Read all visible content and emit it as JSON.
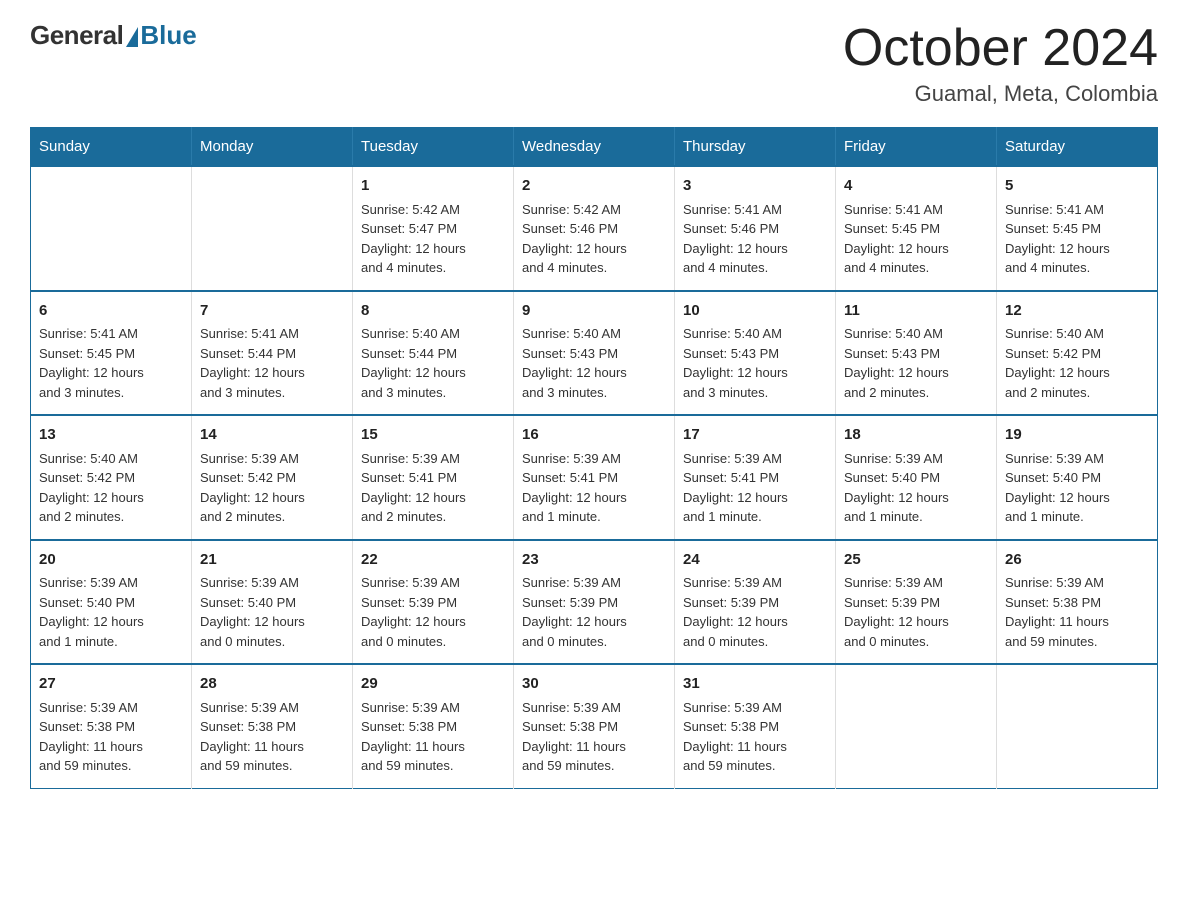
{
  "header": {
    "logo": {
      "general": "General",
      "blue": "Blue",
      "triangle_color": "#1a6b9a"
    },
    "title": "October 2024",
    "location": "Guamal, Meta, Colombia"
  },
  "calendar": {
    "days_of_week": [
      "Sunday",
      "Monday",
      "Tuesday",
      "Wednesday",
      "Thursday",
      "Friday",
      "Saturday"
    ],
    "weeks": [
      {
        "days": [
          {
            "number": "",
            "info": ""
          },
          {
            "number": "",
            "info": ""
          },
          {
            "number": "1",
            "info": "Sunrise: 5:42 AM\nSunset: 5:47 PM\nDaylight: 12 hours\nand 4 minutes."
          },
          {
            "number": "2",
            "info": "Sunrise: 5:42 AM\nSunset: 5:46 PM\nDaylight: 12 hours\nand 4 minutes."
          },
          {
            "number": "3",
            "info": "Sunrise: 5:41 AM\nSunset: 5:46 PM\nDaylight: 12 hours\nand 4 minutes."
          },
          {
            "number": "4",
            "info": "Sunrise: 5:41 AM\nSunset: 5:45 PM\nDaylight: 12 hours\nand 4 minutes."
          },
          {
            "number": "5",
            "info": "Sunrise: 5:41 AM\nSunset: 5:45 PM\nDaylight: 12 hours\nand 4 minutes."
          }
        ]
      },
      {
        "days": [
          {
            "number": "6",
            "info": "Sunrise: 5:41 AM\nSunset: 5:45 PM\nDaylight: 12 hours\nand 3 minutes."
          },
          {
            "number": "7",
            "info": "Sunrise: 5:41 AM\nSunset: 5:44 PM\nDaylight: 12 hours\nand 3 minutes."
          },
          {
            "number": "8",
            "info": "Sunrise: 5:40 AM\nSunset: 5:44 PM\nDaylight: 12 hours\nand 3 minutes."
          },
          {
            "number": "9",
            "info": "Sunrise: 5:40 AM\nSunset: 5:43 PM\nDaylight: 12 hours\nand 3 minutes."
          },
          {
            "number": "10",
            "info": "Sunrise: 5:40 AM\nSunset: 5:43 PM\nDaylight: 12 hours\nand 3 minutes."
          },
          {
            "number": "11",
            "info": "Sunrise: 5:40 AM\nSunset: 5:43 PM\nDaylight: 12 hours\nand 2 minutes."
          },
          {
            "number": "12",
            "info": "Sunrise: 5:40 AM\nSunset: 5:42 PM\nDaylight: 12 hours\nand 2 minutes."
          }
        ]
      },
      {
        "days": [
          {
            "number": "13",
            "info": "Sunrise: 5:40 AM\nSunset: 5:42 PM\nDaylight: 12 hours\nand 2 minutes."
          },
          {
            "number": "14",
            "info": "Sunrise: 5:39 AM\nSunset: 5:42 PM\nDaylight: 12 hours\nand 2 minutes."
          },
          {
            "number": "15",
            "info": "Sunrise: 5:39 AM\nSunset: 5:41 PM\nDaylight: 12 hours\nand 2 minutes."
          },
          {
            "number": "16",
            "info": "Sunrise: 5:39 AM\nSunset: 5:41 PM\nDaylight: 12 hours\nand 1 minute."
          },
          {
            "number": "17",
            "info": "Sunrise: 5:39 AM\nSunset: 5:41 PM\nDaylight: 12 hours\nand 1 minute."
          },
          {
            "number": "18",
            "info": "Sunrise: 5:39 AM\nSunset: 5:40 PM\nDaylight: 12 hours\nand 1 minute."
          },
          {
            "number": "19",
            "info": "Sunrise: 5:39 AM\nSunset: 5:40 PM\nDaylight: 12 hours\nand 1 minute."
          }
        ]
      },
      {
        "days": [
          {
            "number": "20",
            "info": "Sunrise: 5:39 AM\nSunset: 5:40 PM\nDaylight: 12 hours\nand 1 minute."
          },
          {
            "number": "21",
            "info": "Sunrise: 5:39 AM\nSunset: 5:40 PM\nDaylight: 12 hours\nand 0 minutes."
          },
          {
            "number": "22",
            "info": "Sunrise: 5:39 AM\nSunset: 5:39 PM\nDaylight: 12 hours\nand 0 minutes."
          },
          {
            "number": "23",
            "info": "Sunrise: 5:39 AM\nSunset: 5:39 PM\nDaylight: 12 hours\nand 0 minutes."
          },
          {
            "number": "24",
            "info": "Sunrise: 5:39 AM\nSunset: 5:39 PM\nDaylight: 12 hours\nand 0 minutes."
          },
          {
            "number": "25",
            "info": "Sunrise: 5:39 AM\nSunset: 5:39 PM\nDaylight: 12 hours\nand 0 minutes."
          },
          {
            "number": "26",
            "info": "Sunrise: 5:39 AM\nSunset: 5:38 PM\nDaylight: 11 hours\nand 59 minutes."
          }
        ]
      },
      {
        "days": [
          {
            "number": "27",
            "info": "Sunrise: 5:39 AM\nSunset: 5:38 PM\nDaylight: 11 hours\nand 59 minutes."
          },
          {
            "number": "28",
            "info": "Sunrise: 5:39 AM\nSunset: 5:38 PM\nDaylight: 11 hours\nand 59 minutes."
          },
          {
            "number": "29",
            "info": "Sunrise: 5:39 AM\nSunset: 5:38 PM\nDaylight: 11 hours\nand 59 minutes."
          },
          {
            "number": "30",
            "info": "Sunrise: 5:39 AM\nSunset: 5:38 PM\nDaylight: 11 hours\nand 59 minutes."
          },
          {
            "number": "31",
            "info": "Sunrise: 5:39 AM\nSunset: 5:38 PM\nDaylight: 11 hours\nand 59 minutes."
          },
          {
            "number": "",
            "info": ""
          },
          {
            "number": "",
            "info": ""
          }
        ]
      }
    ]
  }
}
